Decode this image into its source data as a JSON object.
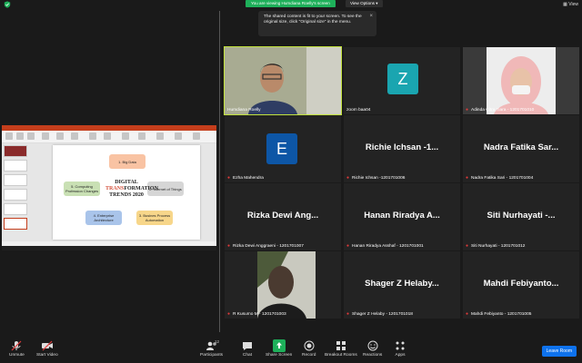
{
  "topbar": {
    "sharing_text": "You are viewing Humdiana Roelly's screen",
    "view_options": "View Options ▾",
    "view_label": "View"
  },
  "tooltip": {
    "text": "The shared content is fit to your screen. To see the original size, click \"Original size\" in the menu.",
    "close": "×"
  },
  "slide": {
    "title_line1": "DIGITAL",
    "title_accent": "TRANS",
    "title_accent2": "FORMATION",
    "title_line3": "TRENDS 2020",
    "nodes": [
      "1. Big Data",
      "2. Internet of Things",
      "3. Busines Process Automation",
      "4. Enterprise Architecture",
      "5. Computing Profession Changes"
    ]
  },
  "participants": [
    {
      "label": "Humdiana Roelly",
      "big": "",
      "muted": false
    },
    {
      "label": "zoom baa04",
      "big": "",
      "muted": false,
      "initial": "Z",
      "color": "#1aa5b0"
    },
    {
      "label": "Adinda Citra Tiara - 1201701010",
      "big": "",
      "muted": true
    },
    {
      "label": "Ezha Mahendra",
      "big": "",
      "muted": true,
      "initial": "E",
      "color": "#0d56a6"
    },
    {
      "label": "Richie Ichsan -1201701006",
      "big": "Richie Ichsan -1...",
      "muted": true
    },
    {
      "label": "Nadra Fatika Sari - 1201701004",
      "big": "Nadra Fatika Sar...",
      "muted": true
    },
    {
      "label": "Rizka Dewi Anggraeni - 1201701007",
      "big": "Rizka Dewi Ang...",
      "muted": true
    },
    {
      "label": "Hanan Riradya Asshaf - 1201701001",
      "big": "Hanan Riradya A...",
      "muted": true
    },
    {
      "label": "Siti Nurhayati - 1201701012",
      "big": "Siti Nurhayati -...",
      "muted": true
    },
    {
      "label": "R Kusumo M - 1201701003",
      "big": "",
      "muted": true
    },
    {
      "label": "Shager Z Helaby - 1201701018",
      "big": "Shager Z Helaby...",
      "muted": true
    },
    {
      "label": "Mahdi Febiyanto - 1201701005",
      "big": "Mahdi Febiyanto...",
      "muted": true
    }
  ],
  "toolbar": {
    "unmute": "Unmute",
    "start_video": "Start Video",
    "participants": "Participants",
    "participants_count": "12",
    "chat": "Chat",
    "share_screen": "Share Screen",
    "record": "Record",
    "breakout": "Breakout Rooms",
    "reactions": "Reactions",
    "apps": "Apps",
    "leave": "Leave Room"
  },
  "colors": {
    "accent_green": "#1eb05a",
    "leave_blue": "#0e72ed",
    "active_speaker": "#c2e23c",
    "muted_red": "#e23b3b"
  }
}
